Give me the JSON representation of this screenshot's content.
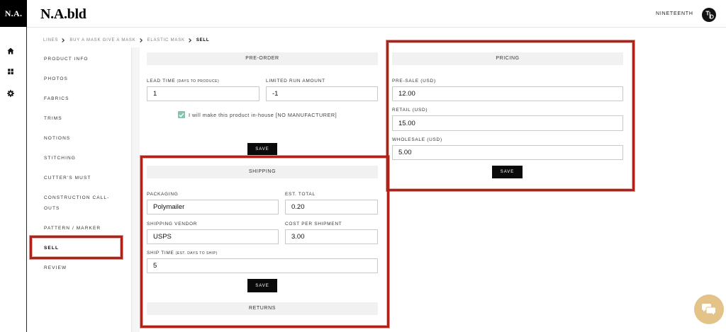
{
  "header": {
    "logo_mark": "N.A.",
    "logo_text": "N.A.bld",
    "user_name": "NINETEENTH"
  },
  "rail": {
    "icons": [
      "home-icon",
      "grid-icon",
      "gear-icon"
    ]
  },
  "breadcrumb": {
    "items": [
      "LINES",
      "BUY A MASK GIVE A MASK",
      "ELASTIC MASK",
      "SELL"
    ],
    "separator_icon": "chevron-right-icon"
  },
  "nav": {
    "active_index": 9,
    "items": [
      "PRODUCT INFO",
      "PHOTOS",
      "FABRICS",
      "TRIMS",
      "NOTIONS",
      "STITCHING",
      "CUTTER'S MUST",
      "CONSTRUCTION CALL-OUTS",
      "PATTERN / MARKER",
      "SELL",
      "REVIEW"
    ]
  },
  "preorder": {
    "title": "PRE-ORDER",
    "lead_time": {
      "label": "LEAD TIME",
      "hint": "(DAYS TO PRODUCE)",
      "value": "1"
    },
    "limited_run": {
      "label": "LIMITED RUN AMOUNT",
      "value": "-1"
    },
    "in_house": {
      "checked": true,
      "label": "I will make this product in-house [NO MANUFACTURER]"
    },
    "save_label": "SAVE"
  },
  "shipping": {
    "title": "SHIPPING",
    "packaging": {
      "label": "PACKAGING",
      "value": "Polymailer"
    },
    "est_total": {
      "label": "EST. TOTAL",
      "value": "0.20"
    },
    "vendor": {
      "label": "SHIPPING VENDOR",
      "value": "USPS"
    },
    "cost_per_shipment": {
      "label": "COST PER SHIPMENT",
      "value": "3.00"
    },
    "ship_time": {
      "label": "SHIP TIME",
      "hint": "(EST. DAYS TO SHIP)",
      "value": "5"
    },
    "save_label": "SAVE"
  },
  "returns": {
    "title": "RETURNS"
  },
  "pricing": {
    "title": "PRICING",
    "pre_sale": {
      "label": "PRE-SALE (USD)",
      "value": "12.00"
    },
    "retail": {
      "label": "RETAIL (USD)",
      "value": "15.00"
    },
    "wholesale": {
      "label": "WHOLESALE (USD)",
      "value": "5.00"
    },
    "save_label": "SAVE"
  },
  "chat": {
    "icon": "chat-icon"
  },
  "colors": {
    "checkbox_accent": "#86c3ab",
    "annotation_red": "#ad2219",
    "chat_bubble": "#e3c387",
    "button_bg": "#0a0a0a",
    "section_header_bg": "#f1f1f1"
  }
}
